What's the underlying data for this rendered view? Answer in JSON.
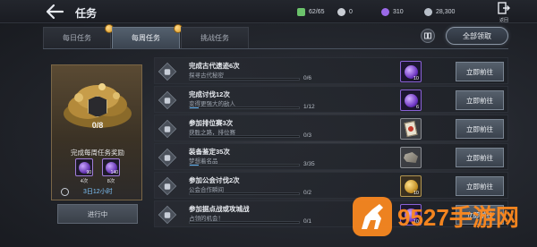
{
  "header": {
    "title": "任务",
    "resources": [
      {
        "icon": "green-resource-icon",
        "value": "62/65",
        "color": "#6bc26b"
      },
      {
        "icon": "silver-coin-icon",
        "value": "0",
        "color": "#c9cdd4"
      },
      {
        "icon": "purple-gem-icon",
        "value": "310",
        "color": "#9b6ae8"
      },
      {
        "icon": "gold-coin-icon",
        "value": "28,300",
        "color": "#b8bfc9"
      }
    ],
    "exit_label": "返回"
  },
  "tabs": [
    {
      "label": "每日任务",
      "active": false,
      "badge": true
    },
    {
      "label": "每周任务",
      "active": true,
      "badge": true
    },
    {
      "label": "挑战任务",
      "active": false,
      "badge": false
    }
  ],
  "claim_all_label": "全部领取",
  "reward_panel": {
    "progress": "0/8",
    "title": "完成每周任务奖励",
    "items": [
      {
        "icon": "purple-gem-icon",
        "num": "90",
        "count": "4次"
      },
      {
        "icon": "purple-gem-icon",
        "num": "140",
        "count": "8次"
      }
    ],
    "timer": "3日12小时",
    "status_label": "进行中"
  },
  "tasks": [
    {
      "name": "完成古代遗迹6次",
      "desc": "探寻古代秘密",
      "count": "0/6",
      "progress": 0.0,
      "reward": {
        "type": "purple",
        "icon": "purple-gem-icon",
        "num": "10"
      },
      "button": "立即前往"
    },
    {
      "name": "完成讨伐12次",
      "desc": "变得更强大的敌人",
      "count": "1/12",
      "progress": 0.0833,
      "reward": {
        "type": "purple",
        "icon": "purple-gem-icon",
        "num": "6"
      },
      "button": "立即前往"
    },
    {
      "name": "参加排位赛3次",
      "desc": "获胜之路，排位赛",
      "count": "0/3",
      "progress": 0.0,
      "reward": {
        "type": "gray",
        "icon": "card-pack-icon",
        "num": ""
      },
      "button": "立即前往"
    },
    {
      "name": "装备鉴定35次",
      "desc": "梦想着名品",
      "count": "3/35",
      "progress": 0.0857,
      "reward": {
        "type": "gray",
        "icon": "ore-icon",
        "num": ""
      },
      "button": "立即前往"
    },
    {
      "name": "参加公会讨伐2次",
      "desc": "公会合作瞬间",
      "count": "0/2",
      "progress": 0.0,
      "reward": {
        "type": "gold",
        "icon": "gold-coin-icon",
        "num": "10"
      },
      "button": "立即前往"
    },
    {
      "name": "参加据点战或攻城战",
      "desc": "占领的机会！",
      "count": "0/1",
      "progress": 0.0,
      "reward": {
        "type": "purple",
        "icon": "purple-gem-icon",
        "num": "10"
      },
      "button": "立即前往"
    }
  ],
  "watermark": {
    "text": "9527手游网"
  }
}
